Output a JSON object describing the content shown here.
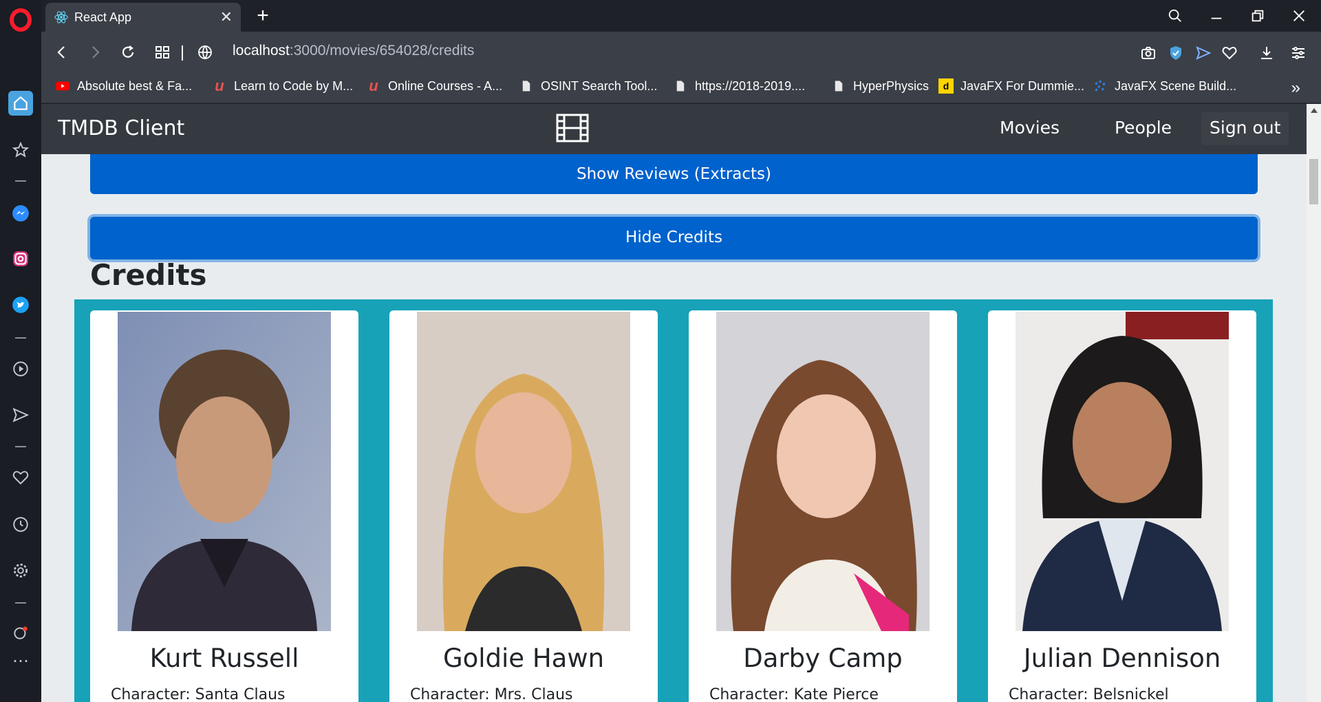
{
  "browser": {
    "tab_title": "React App",
    "url_host": "localhost",
    "url_rest": ":3000/movies/654028/credits",
    "bookmarks": [
      {
        "label": "Absolute best & Fa...",
        "icon": "youtube-icon",
        "color": "#ff0000"
      },
      {
        "label": "Learn to Code by M...",
        "icon": "udemy-icon",
        "color": "#ec5252"
      },
      {
        "label": "Online Courses - A...",
        "icon": "udemy-icon",
        "color": "#ec5252"
      },
      {
        "label": "OSINT Search Tool...",
        "icon": "page-icon",
        "color": "#ffffff"
      },
      {
        "label": "https://2018-2019....",
        "icon": "page-icon",
        "color": "#ffffff"
      },
      {
        "label": "HyperPhysics",
        "icon": "page-icon",
        "color": "#ffffff"
      },
      {
        "label": "JavaFX For Dummie...",
        "icon": "dummies-icon",
        "color": "#ffd400"
      },
      {
        "label": "JavaFX Scene Build...",
        "icon": "gluon-icon",
        "color": "#2f7bd9"
      }
    ],
    "more_bookmarks": "»"
  },
  "app": {
    "brand": "TMDB Client",
    "nav": {
      "movies": "Movies",
      "people": "People",
      "signout": "Sign out"
    },
    "show_reviews": "Show Reviews (Extracts)",
    "hide_credits": "Hide Credits",
    "credits_heading": "Credits"
  },
  "credits": [
    {
      "name": "Kurt Russell",
      "character": "Character: Santa Claus"
    },
    {
      "name": "Goldie Hawn",
      "character": "Character: Mrs. Claus"
    },
    {
      "name": "Darby Camp",
      "character": "Character: Kate Pierce"
    },
    {
      "name": "Julian Dennison",
      "character": "Character: Belsnickel"
    }
  ],
  "colors": {
    "accent": "#0062cc",
    "grid": "#17a2b8",
    "navbar": "#343a40",
    "browser_chrome": "#3b3f47",
    "opera_red": "#ff1b2d"
  }
}
